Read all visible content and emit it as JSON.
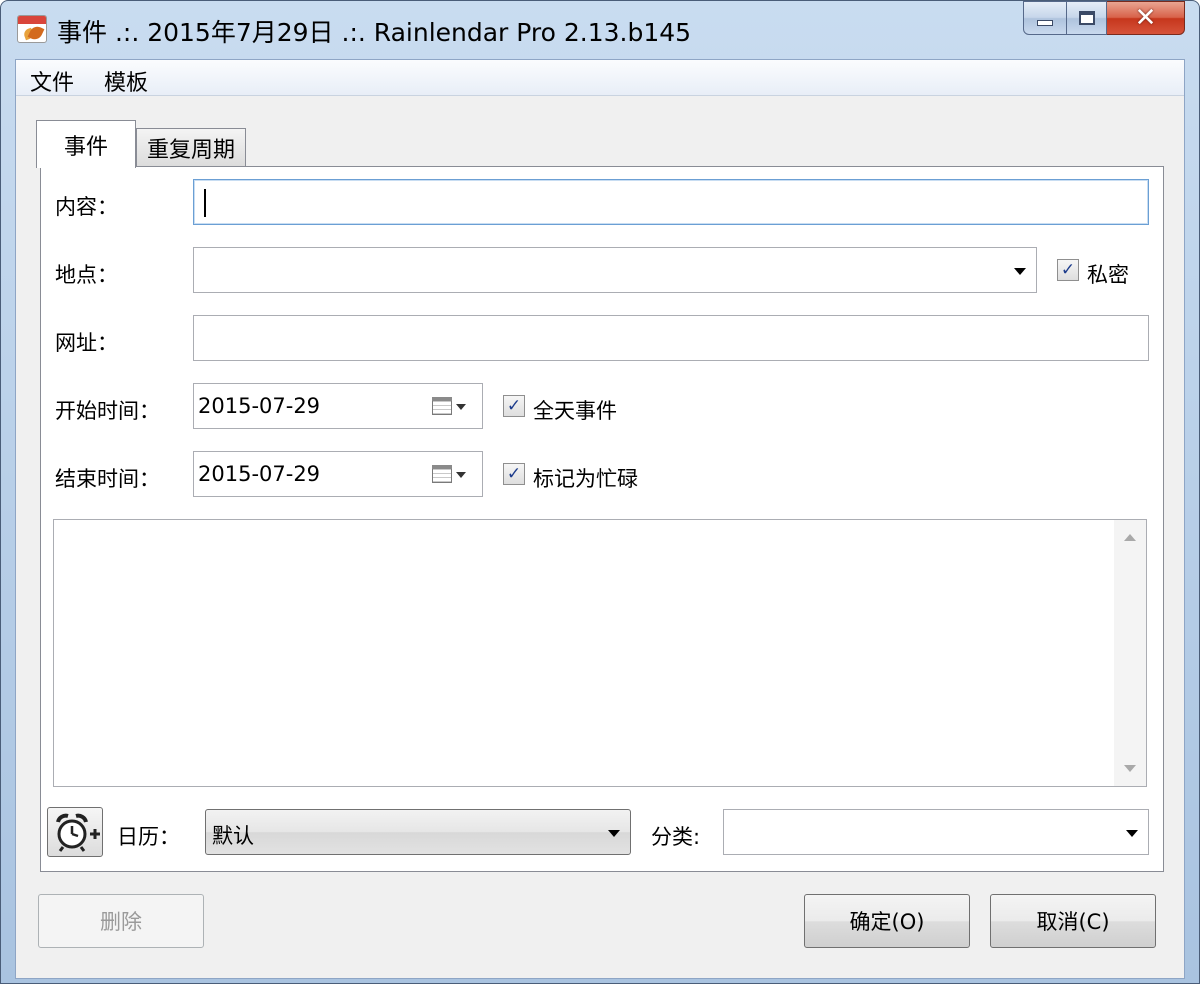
{
  "window": {
    "title": "事件 .:. 2015年7月29日 .:. Rainlendar Pro 2.13.b145"
  },
  "menu": {
    "file": "文件",
    "template": "模板"
  },
  "tabs": {
    "event": "事件",
    "recurrence": "重复周期"
  },
  "form": {
    "content_label": "内容：",
    "content_value": "",
    "location_label": "地点：",
    "location_value": "",
    "private_label": "私密",
    "private_checked": true,
    "url_label": "网址：",
    "url_value": "",
    "start_label": "开始时间：",
    "start_date": "2015-07-29",
    "allday_label": "全天事件",
    "allday_checked": true,
    "end_label": "结束时间：",
    "end_date": "2015-07-29",
    "busy_label": "标记为忙碌",
    "busy_checked": true,
    "notes_value": ""
  },
  "bottom": {
    "alarm_icon": "alarm-clock-add-icon",
    "calendar_label": "日历：",
    "calendar_value": "默认",
    "category_label": "分类:",
    "category_value": ""
  },
  "buttons": {
    "delete": "删除",
    "ok": "确定(O)",
    "cancel": "取消(C)"
  }
}
